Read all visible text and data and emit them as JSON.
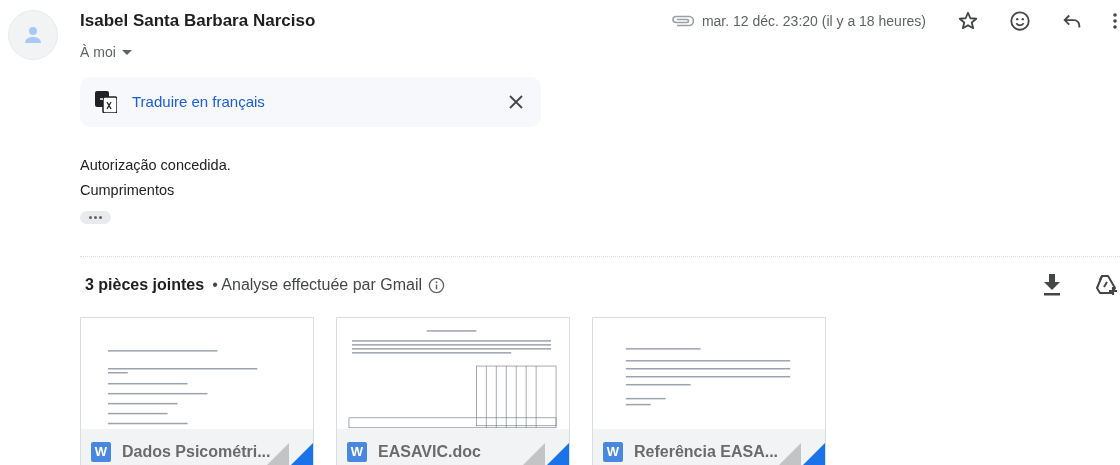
{
  "sender": {
    "name": "Isabel Santa Barbara Narciso",
    "recipient": "À moi"
  },
  "date": "mar. 12 déc. 23:20 (il y a 18 heures)",
  "translate_bar": {
    "label": "Traduire en français"
  },
  "body": [
    "Autorização concedida.",
    "Cumprimentos"
  ],
  "attachments_header": {
    "count": "3 pièces jointes",
    "scan_note": "• Analyse effectuée par Gmail"
  },
  "attachments": [
    {
      "name": "Dados Psicométri...",
      "icon_letter": "W",
      "kind": "list"
    },
    {
      "name": "EASAVIC.doc",
      "icon_letter": "W",
      "kind": "table"
    },
    {
      "name": "Referência EASA...",
      "icon_letter": "W",
      "kind": "paragraph"
    }
  ]
}
